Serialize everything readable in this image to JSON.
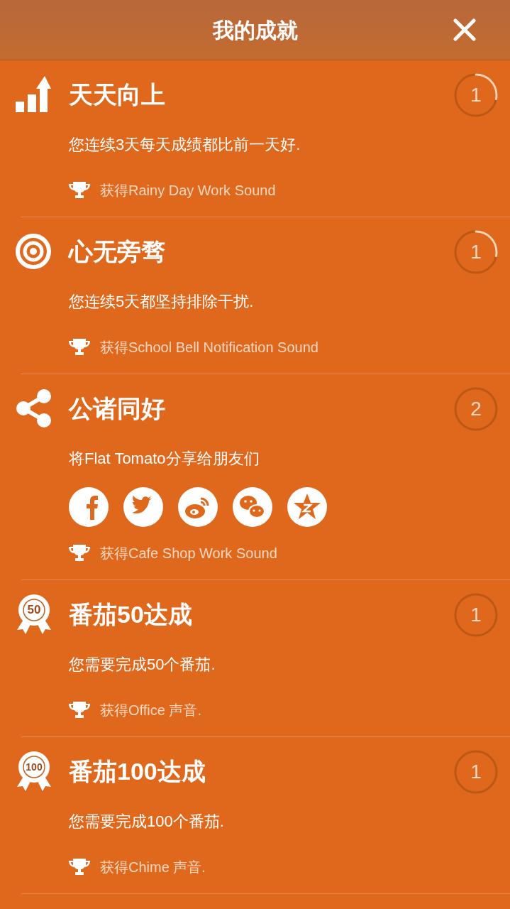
{
  "header": {
    "title": "我的成就"
  },
  "achievements": [
    {
      "kind": "trend",
      "title": "天天向上",
      "description": "您连续3天每天成绩都比前一天好.",
      "reward": "获得Rainy Day Work Sound",
      "count": "1",
      "in_progress": true
    },
    {
      "kind": "target",
      "title": "心无旁骛",
      "description": "您连续5天都坚持排除干扰.",
      "reward": "获得School Bell Notification Sound",
      "count": "1",
      "in_progress": true
    },
    {
      "kind": "share",
      "title": "公诸同好",
      "description": "将Flat Tomato分享给朋友们",
      "social": [
        {
          "kind": "facebook"
        },
        {
          "kind": "twitter"
        },
        {
          "kind": "weibo"
        },
        {
          "kind": "wechat"
        },
        {
          "kind": "qzone"
        }
      ],
      "reward": "获得Cafe Shop Work Sound",
      "count": "2",
      "in_progress": false
    },
    {
      "kind": "medal",
      "medal_label": "50",
      "title": "番茄50达成",
      "description": "您需要完成50个番茄.",
      "reward": "获得Office 声音.",
      "count": "1",
      "in_progress": false
    },
    {
      "kind": "medal",
      "medal_label": "100",
      "title": "番茄100达成",
      "description": "您需要完成100个番茄.",
      "reward": "获得Chime 声音.",
      "count": "1",
      "in_progress": false
    }
  ]
}
